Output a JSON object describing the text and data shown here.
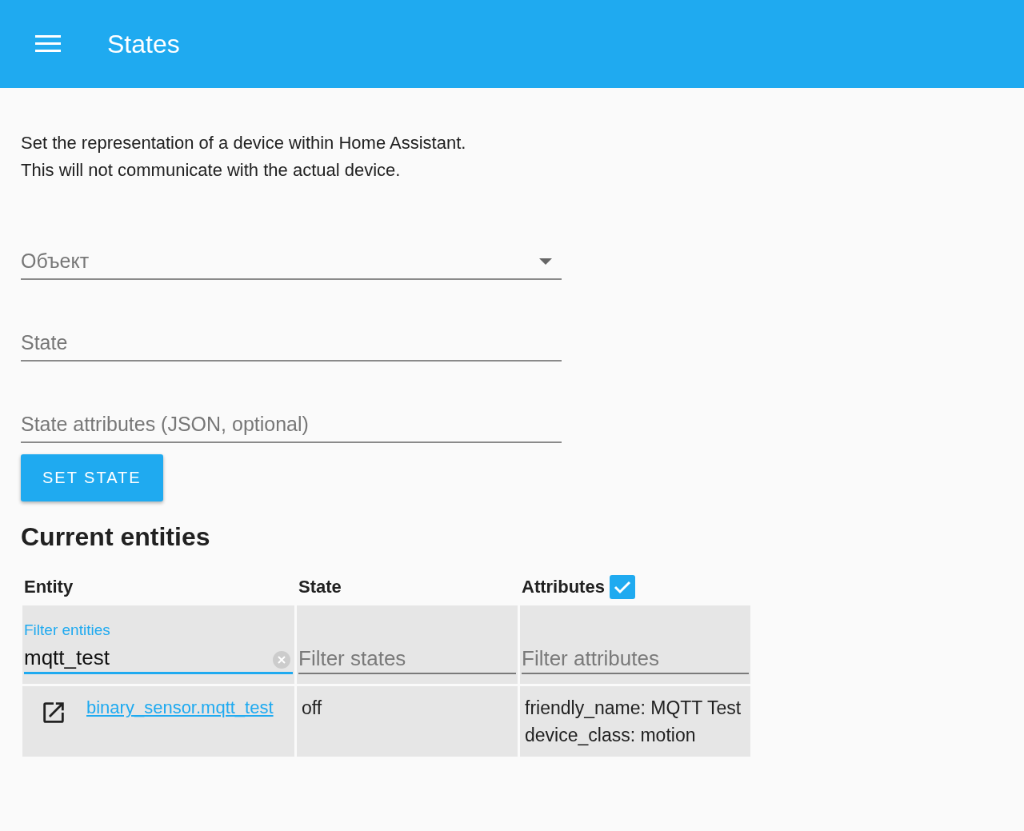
{
  "header": {
    "title": "States"
  },
  "description": [
    "Set the representation of a device within Home Assistant.",
    "This will not communicate with the actual device."
  ],
  "form": {
    "fields": [
      {
        "kind": "dropdown",
        "placeholder": "Объект"
      },
      {
        "kind": "text",
        "placeholder": "State"
      },
      {
        "kind": "text",
        "placeholder": "State attributes (JSON, optional)"
      }
    ],
    "button": "SET STATE"
  },
  "entities": {
    "title": "Current entities",
    "columns": [
      "Entity",
      "State",
      "Attributes"
    ],
    "attributes_checked": true,
    "filters": [
      {
        "label": "Filter entities",
        "value": "mqtt_test",
        "focused": true
      },
      {
        "placeholder": "Filter states",
        "focused": false
      },
      {
        "placeholder": "Filter attributes",
        "focused": false
      }
    ],
    "rows": [
      {
        "entity": "binary_sensor.mqtt_test",
        "state": "off",
        "attributes": [
          "friendly_name: MQTT Test",
          "device_class: motion"
        ]
      }
    ]
  }
}
